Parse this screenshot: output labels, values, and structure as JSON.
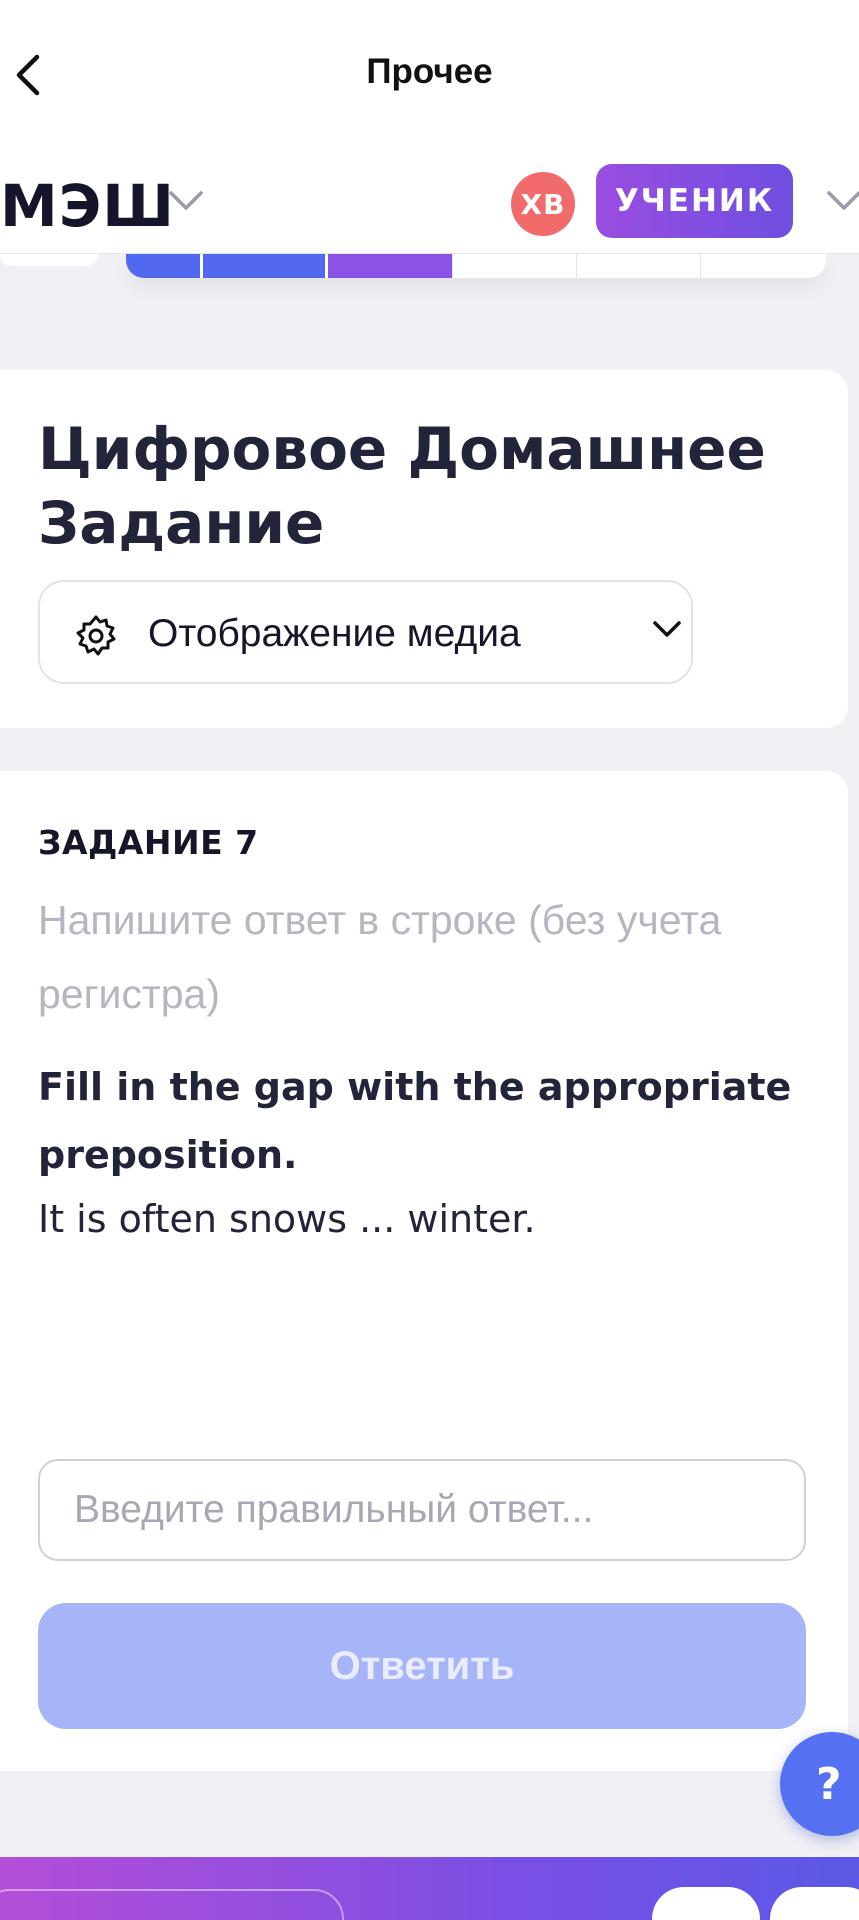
{
  "nav": {
    "title": "Прочее",
    "back_icon": "chevron-left-icon"
  },
  "header": {
    "brand": "МЭШ",
    "avatar_initials": "ХВ",
    "role_label": "УЧЕНИК",
    "colors": {
      "avatar": "#f26b6b",
      "role_start": "#9a4de0",
      "role_end": "#6d4fe0"
    }
  },
  "card_title": {
    "title": "Цифровое Домашнее Задание",
    "media_select_label": "Отображение медиа",
    "media_select_icon": "gear-icon"
  },
  "task": {
    "number_label": "ЗАДАНИЕ 7",
    "hint": "Напишите ответ в строке (без учета регистра)",
    "question": "Fill in the gap with the appropriate preposition.",
    "sentence": "It is often snows ... winter.",
    "input_placeholder": "Введите правильный ответ...",
    "input_value": "",
    "submit_label": "Ответить",
    "submit_color": "#a6b4f8"
  },
  "help": {
    "label": "?",
    "color": "#5670f2"
  }
}
